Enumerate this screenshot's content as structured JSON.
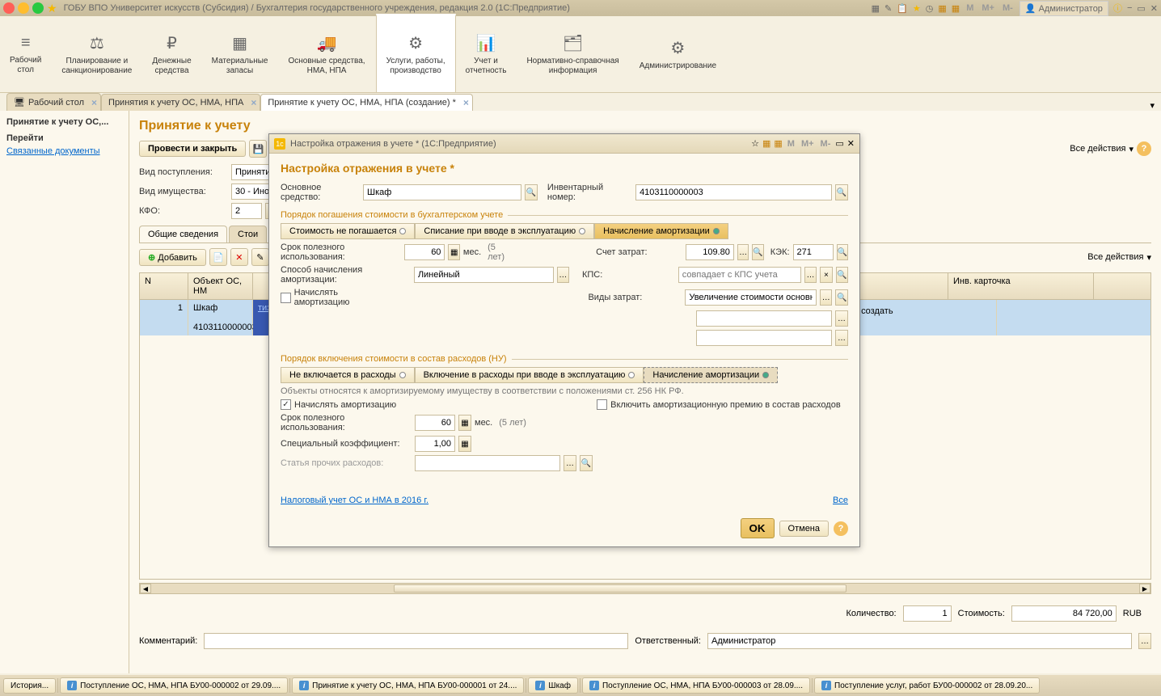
{
  "app_title": "ГОБУ ВПО Университет искусств (Субсидия) / Бухгалтерия государственного учреждения, редакция 2.0  (1С:Предприятие)",
  "title_right": {
    "m": "M",
    "m_plus": "M+",
    "m_minus": "M-",
    "admin": "Администратор"
  },
  "sections": [
    {
      "label": "Рабочий\nстол"
    },
    {
      "label": "Планирование и\nсанкционирование"
    },
    {
      "label": "Денежные\nсредства"
    },
    {
      "label": "Материальные\nзапасы"
    },
    {
      "label": "Основные средства,\nНМА, НПА"
    },
    {
      "label": "Услуги, работы,\nпроизводство"
    },
    {
      "label": "Учет и\nотчетность"
    },
    {
      "label": "Нормативно-справочная\nинформация"
    },
    {
      "label": "Администрирование"
    }
  ],
  "doc_tabs": [
    {
      "label": "Рабочий стол"
    },
    {
      "label": "Принятия к учету ОС, НМА, НПА"
    },
    {
      "label": "Принятие к учету ОС, НМА, НПА (создание) *"
    }
  ],
  "sidebar": {
    "title": "Принятие к учету ОС,...",
    "links": [
      "Перейти",
      "Связанные документы"
    ]
  },
  "page": {
    "title": "Принятие к учету",
    "toolbar": {
      "main_btn": "Провести и закрыть"
    },
    "all_actions": "Все действия",
    "fields": {
      "receipt_type_label": "Вид поступления:",
      "receipt_type_value": "Принятие к",
      "property_type_label": "Вид имущества:",
      "property_type_value": "30 - Иное д",
      "kfo_label": "КФО:",
      "kfo_value": "2"
    },
    "inner_tabs": [
      "Общие сведения",
      "Стои"
    ],
    "table_toolbar": {
      "add": "Добавить"
    },
    "table": {
      "headers": [
        "N",
        "Объект ОС, НМ",
        "Инв. карточка"
      ],
      "rows": [
        {
          "n": "1",
          "obj": "Шкаф",
          "inv": "4103110000003",
          "card": "создать",
          "card_link": "тизации"
        }
      ]
    },
    "summary": {
      "qty_label": "Количество:",
      "qty_value": "1",
      "cost_label": "Стоимость:",
      "cost_value": "84 720,00",
      "currency": "RUB",
      "comment_label": "Комментарий:",
      "responsible_label": "Ответственный:",
      "responsible_value": "Администратор"
    }
  },
  "modal": {
    "title": "Настройка отражения в учете *  (1С:Предприятие)",
    "heading": "Настройка отражения в учете *",
    "m": "M",
    "m_plus": "M+",
    "m_minus": "M-",
    "asset_label": "Основное средство:",
    "asset_value": "Шкаф",
    "inv_label": "Инвентарный номер:",
    "inv_value": "4103110000003",
    "group1_title": "Порядок погашения стоимости в бухгалтерском учете",
    "segments1": [
      "Стоимость не погашается",
      "Списание при вводе в эксплуатацию",
      "Начисление амортизации"
    ],
    "life_label": "Срок полезного использования:",
    "life_value": "60",
    "life_unit": "мес.",
    "life_hint": "(5 лет)",
    "account_label": "Счет затрат:",
    "account_value": "109.80",
    "kek_label": "КЭК:",
    "kek_value": "271",
    "method_label": "Способ начисления амортизации:",
    "method_value": "Линейный",
    "kps_label": "КПС:",
    "kps_placeholder": "совпадает с КПС учета",
    "accrue_label": "Начислять амортизацию",
    "types_label": "Виды затрат:",
    "types_value": "Увеличение стоимости основнь",
    "group2_title": "Порядок включения стоимости в состав расходов (НУ)",
    "segments2": [
      "Не включается в расходы",
      "Включение в расходы при вводе в эксплуатацию",
      "Начисление амортизации"
    ],
    "amort_note": "Объекты относятся к амортизируемому имуществу в соответствии с положениями ст. 256 НК РФ.",
    "accrue2_label": "Начислять амортизацию",
    "premium_label": "Включить амортизационную премию в состав расходов",
    "life2_label": "Срок полезного использования:",
    "life2_value": "60",
    "coef_label": "Специальный коэффициент:",
    "coef_value": "1,00",
    "article_label": "Статья прочих расходов:",
    "tax_link": "Налоговый учет ОС и НМА в 2016 г.",
    "all_link": "Все",
    "ok": "OK",
    "cancel": "Отмена"
  },
  "taskbar": {
    "history": "История...",
    "items": [
      "Поступление ОС, НМА, НПА БУ00-000002 от 29.09....",
      "Принятие к учету ОС, НМА, НПА БУ00-000001 от 24....",
      "Шкаф",
      "Поступление ОС, НМА, НПА БУ00-000003 от 28.09....",
      "Поступление услуг, работ БУ00-000002 от 28.09.20..."
    ]
  }
}
